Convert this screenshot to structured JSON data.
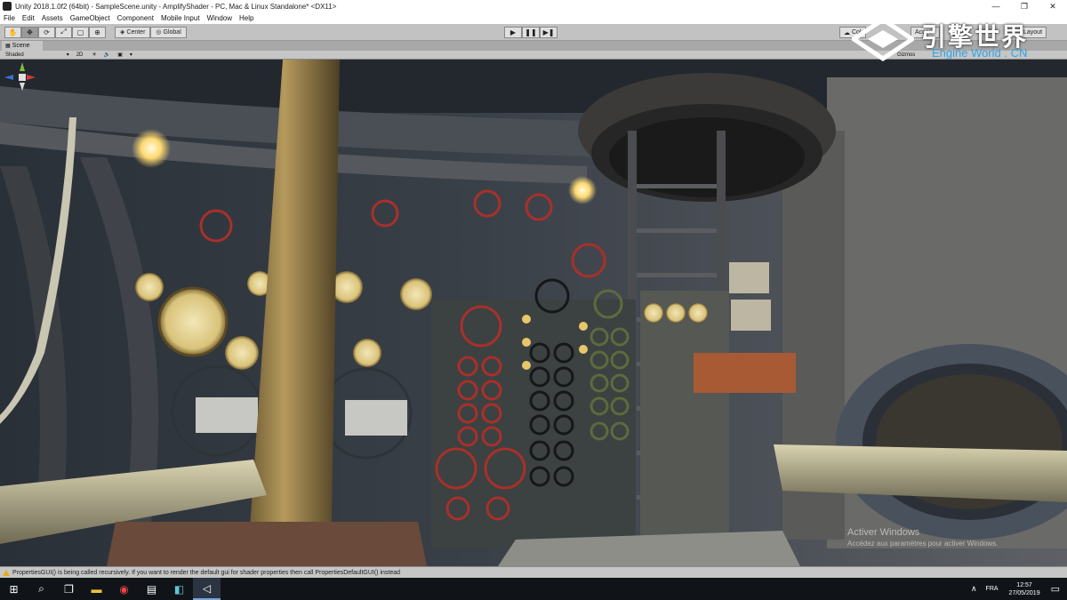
{
  "window": {
    "title": "Unity 2018.1.0f2 (64bit) - SampleScene.unity - AmplifyShader - PC, Mac & Linux Standalone* <DX11>",
    "controls": {
      "minimize": "—",
      "maximize": "❐",
      "close": "✕"
    }
  },
  "menu": [
    "File",
    "Edit",
    "Assets",
    "GameObject",
    "Component",
    "Mobile Input",
    "Window",
    "Help"
  ],
  "toolbar": {
    "pivot": "Center",
    "space": "Global",
    "collab": "Col",
    "account": "Accoun",
    "layout": "Layout"
  },
  "scene": {
    "tab_label": "Scene",
    "shading_mode": "Shaded",
    "mode_2d": "2D",
    "gizmos_label": "Gizmos"
  },
  "watermark": {
    "cn": "引擎世界",
    "en": "Engine World . CN"
  },
  "activation": {
    "line1": "Activer Windows",
    "line2": "Accédez aux paramètres pour activer Windows."
  },
  "status": {
    "message": "PropertiesGUI() is being called recursively. If you want to render the default gui for shader properties then call PropertiesDefaultGUI() instead"
  },
  "taskbar": {
    "language": "FRA",
    "time": "12:57",
    "date": "27/05/2019"
  },
  "colors": {
    "accent_blue": "#2fa4e7",
    "warning": "#e8a81c",
    "valve_red": "#a8302a",
    "brass": "#c9a84a"
  }
}
